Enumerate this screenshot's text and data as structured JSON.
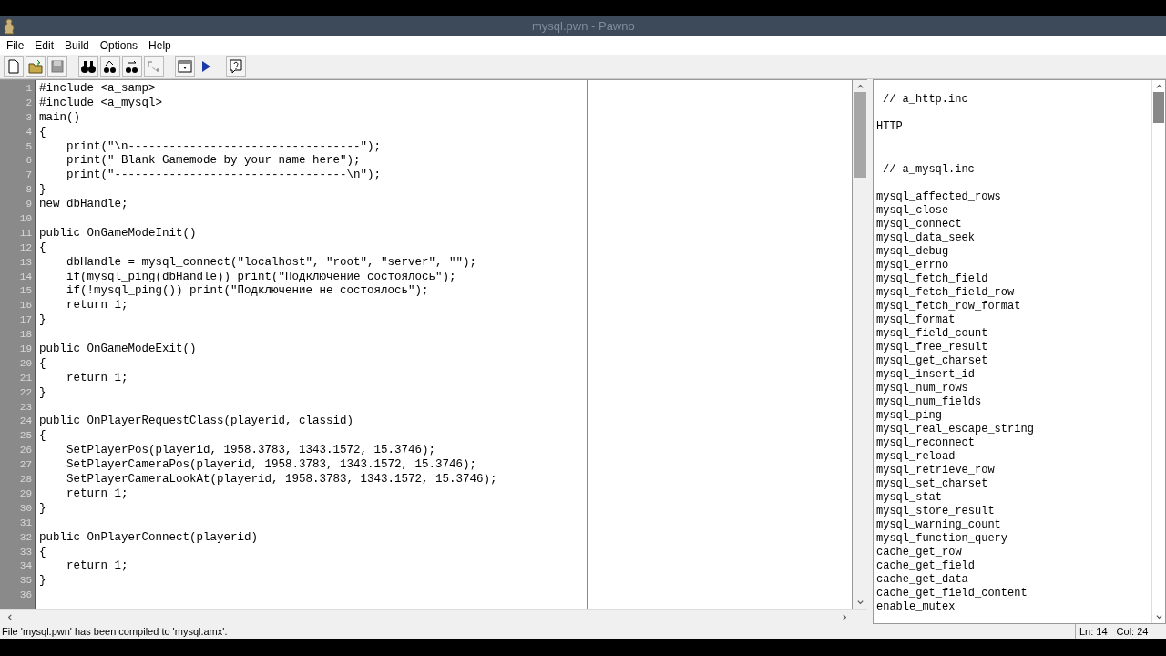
{
  "window": {
    "title": "mysql.pwn - Pawno"
  },
  "menu": [
    "File",
    "Edit",
    "Build",
    "Options",
    "Help"
  ],
  "editor": {
    "lines": [
      {
        "number": "1",
        "text": "#include <a_samp>"
      },
      {
        "number": "2",
        "text": "#include <a_mysql>"
      },
      {
        "number": "3",
        "text": "main()"
      },
      {
        "number": "4",
        "text": "{"
      },
      {
        "number": "5",
        "text": "    print(\"\\n----------------------------------\");"
      },
      {
        "number": "6",
        "text": "    print(\" Blank Gamemode by your name here\");"
      },
      {
        "number": "7",
        "text": "    print(\"----------------------------------\\n\");"
      },
      {
        "number": "8",
        "text": "}"
      },
      {
        "number": "9",
        "text": "new dbHandle;"
      },
      {
        "number": "10"
      },
      {
        "number": "11",
        "text": "public OnGameModeInit()"
      },
      {
        "number": "12",
        "text": "{"
      },
      {
        "number": "13",
        "text": "    dbHandle = mysql_connect(\"localhost\", \"root\", \"server\", \"\");"
      },
      {
        "number": "14",
        "text": "    if(mysql_ping(dbHandle)) print(\"Подключение состоялось\");"
      },
      {
        "number": "15",
        "text": "    if(!mysql_ping()) print(\"Подключение не состоялось\");"
      },
      {
        "number": "16",
        "text": "    return 1;"
      },
      {
        "number": "17",
        "text": "}"
      },
      {
        "number": "18"
      },
      {
        "number": "19",
        "text": "public OnGameModeExit()"
      },
      {
        "number": "20",
        "text": "{"
      },
      {
        "number": "21",
        "text": "    return 1;"
      },
      {
        "number": "22",
        "text": "}"
      },
      {
        "number": "23"
      },
      {
        "number": "24",
        "text": "public OnPlayerRequestClass(playerid, classid)"
      },
      {
        "number": "25",
        "text": "{"
      },
      {
        "number": "26",
        "text": "    SetPlayerPos(playerid, 1958.3783, 1343.1572, 15.3746);"
      },
      {
        "number": "27",
        "text": "    SetPlayerCameraPos(playerid, 1958.3783, 1343.1572, 15.3746);"
      },
      {
        "number": "28",
        "text": "    SetPlayerCameraLookAt(playerid, 1958.3783, 1343.1572, 15.3746);"
      },
      {
        "number": "29",
        "text": "    return 1;"
      },
      {
        "number": "30",
        "text": "}"
      },
      {
        "number": "31"
      },
      {
        "number": "32",
        "text": "public OnPlayerConnect(playerid)"
      },
      {
        "number": "33",
        "text": "{"
      },
      {
        "number": "34",
        "text": "    return 1;"
      },
      {
        "number": "35",
        "text": "}"
      },
      {
        "number": "36"
      }
    ]
  },
  "function_list": [
    {
      "header": "// a_http.inc",
      "items": [
        "HTTP"
      ]
    },
    {
      "header": "// a_mysql.inc",
      "items": [
        "mysql_affected_rows",
        "mysql_close",
        "mysql_connect",
        "mysql_data_seek",
        "mysql_debug",
        "mysql_errno",
        "mysql_fetch_field",
        "mysql_fetch_field_row",
        "mysql_fetch_row_format",
        "mysql_format",
        "mysql_field_count",
        "mysql_free_result",
        "mysql_get_charset",
        "mysql_insert_id",
        "mysql_num_rows",
        "mysql_num_fields",
        "mysql_ping",
        "mysql_real_escape_string",
        "mysql_reconnect",
        "mysql_reload",
        "mysql_retrieve_row",
        "mysql_set_charset",
        "mysql_stat",
        "mysql_store_result",
        "mysql_warning_count",
        "mysql_function_query",
        "cache_get_row",
        "cache_get_field",
        "cache_get_data",
        "cache_get_field_content",
        "enable_mutex"
      ]
    }
  ],
  "status_bar": {
    "message": "File 'mysql.pwn' has been compiled to 'mysql.amx'.",
    "line": "Ln: 14",
    "column": "Col: 24"
  }
}
